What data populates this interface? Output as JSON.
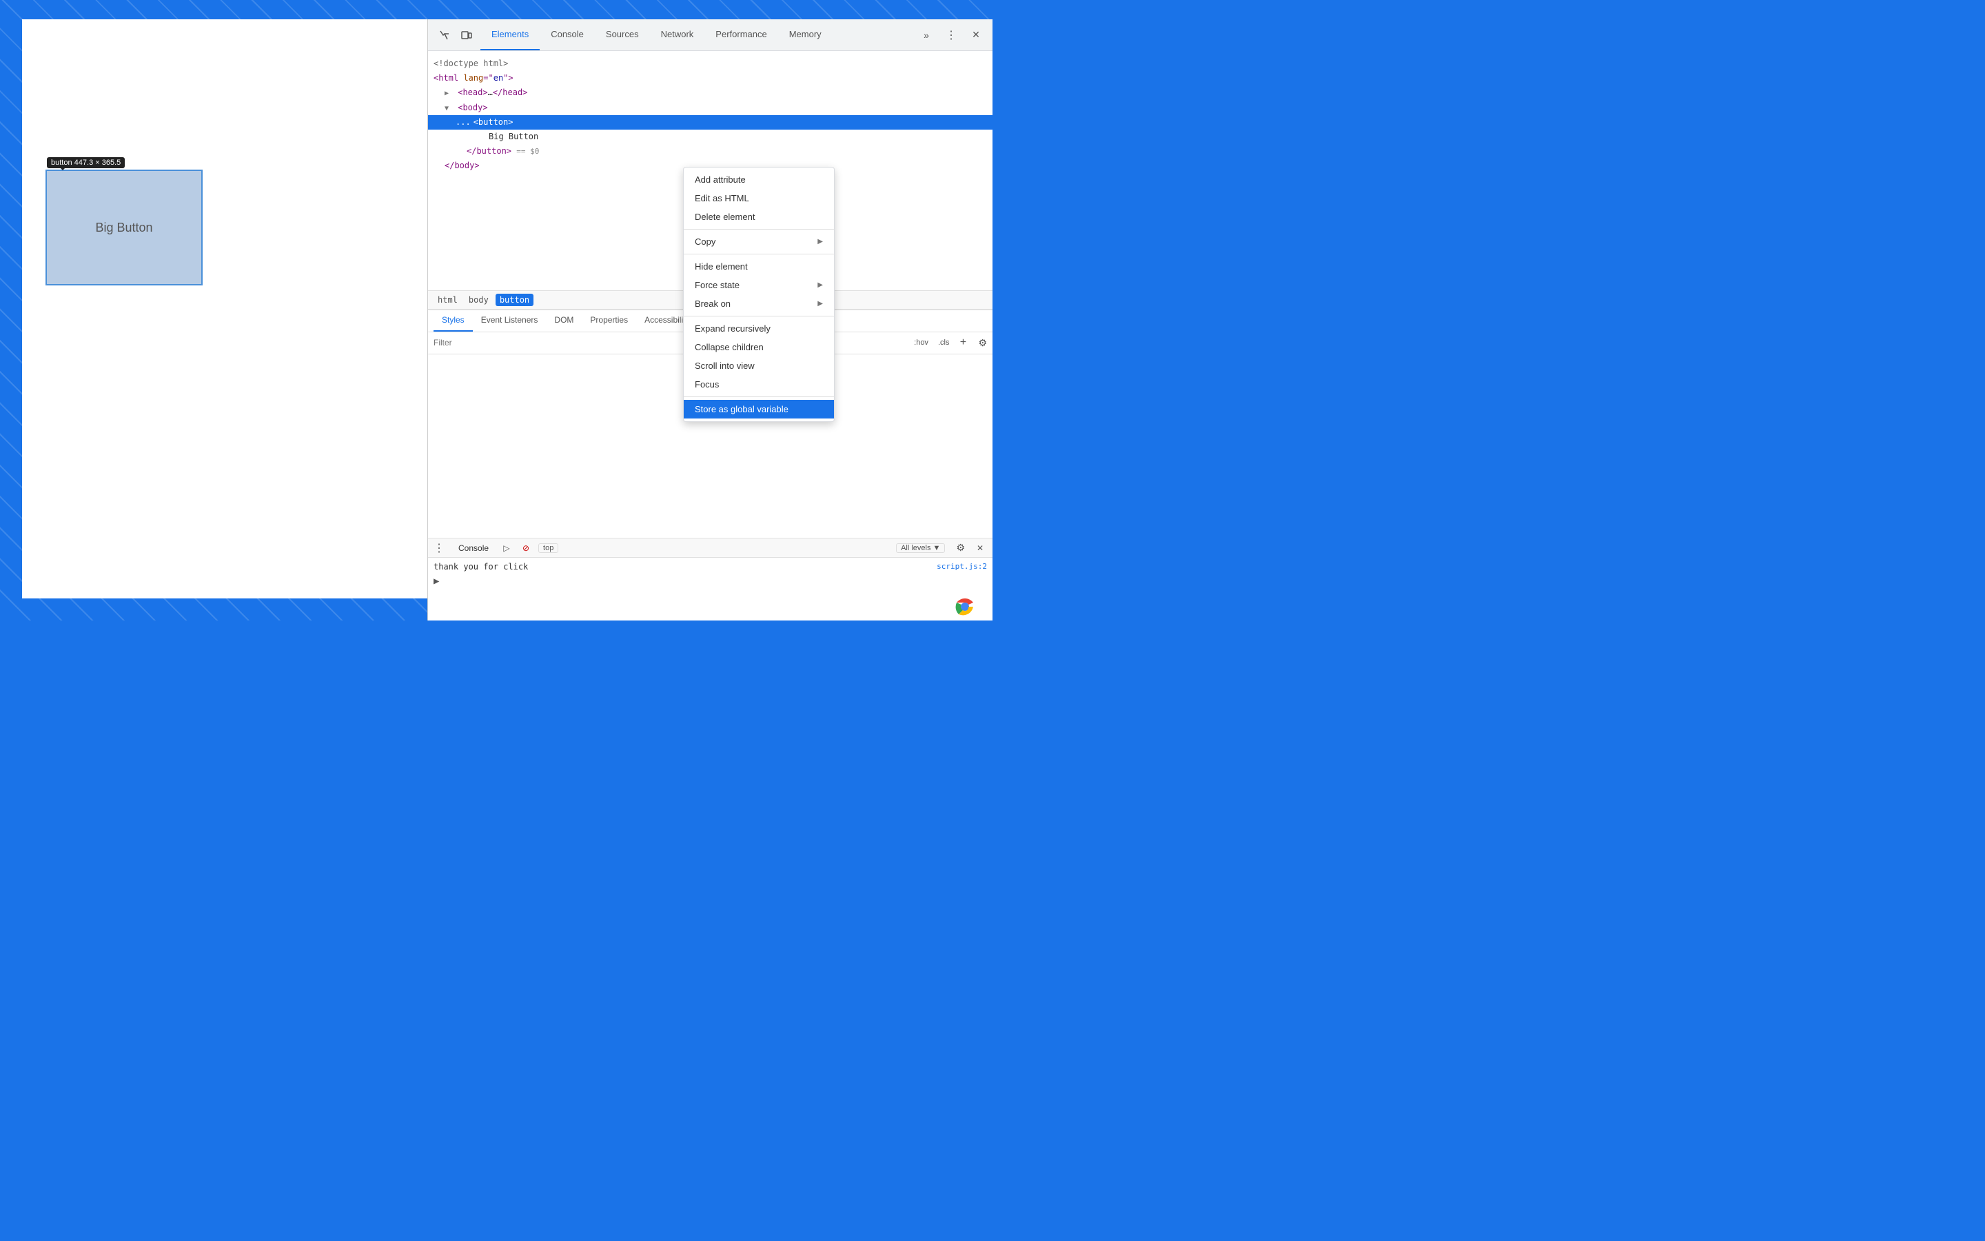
{
  "browser": {
    "top_bar_height": 28
  },
  "tooltip": {
    "text": "button",
    "dimensions": "447.3 × 365.5"
  },
  "big_button": {
    "label": "Big Button"
  },
  "devtools": {
    "toolbar": {
      "inspect_icon": "⬚",
      "device_icon": "⧉",
      "more_tabs_icon": "»",
      "three_dots_icon": "⋮",
      "close_icon": "✕"
    },
    "tabs": [
      {
        "label": "Elements",
        "active": true
      },
      {
        "label": "Console",
        "active": false
      },
      {
        "label": "Sources",
        "active": false
      },
      {
        "label": "Network",
        "active": false
      },
      {
        "label": "Performance",
        "active": false
      },
      {
        "label": "Memory",
        "active": false
      }
    ],
    "html": {
      "lines": [
        {
          "text": "<!doctype html>",
          "type": "doctype",
          "indent": 0
        },
        {
          "text": "<html lang=\"en\">",
          "type": "tag",
          "indent": 0,
          "expandable": false
        },
        {
          "text": "▶ <head>...</head>",
          "type": "tag",
          "indent": 1,
          "collapsed": true
        },
        {
          "text": "▼ <body>",
          "type": "tag",
          "indent": 1,
          "collapsed": false
        },
        {
          "text": "...  <button>",
          "type": "selected",
          "indent": 2
        },
        {
          "text": "Big Button",
          "type": "text",
          "indent": 4
        },
        {
          "text": "</button> == $0",
          "type": "tag",
          "indent": 3
        },
        {
          "text": "</body>",
          "type": "tag",
          "indent": 1
        }
      ]
    },
    "breadcrumb": [
      {
        "label": "html",
        "active": false
      },
      {
        "label": "body",
        "active": false
      },
      {
        "label": "button",
        "active": true
      }
    ],
    "styles_tabs": [
      {
        "label": "Styles",
        "active": true
      },
      {
        "label": "Event Listeners",
        "active": false
      },
      {
        "label": "DOM",
        "active": false
      },
      {
        "label": "Properties",
        "active": false
      },
      {
        "label": "Accessibility",
        "active": false
      }
    ],
    "filter_placeholder": "Filter",
    "hov_label": ":hov",
    "cls_label": ".cls",
    "plus_label": "+",
    "gear_label": "⚙",
    "console": {
      "title": "Console",
      "log_text": "thank you for click",
      "log_source": "script.js:2",
      "top_label": "top",
      "all_levels_label": "All levels ▼",
      "prompt": ">"
    }
  },
  "context_menu": {
    "items": [
      {
        "label": "Add attribute",
        "has_submenu": false
      },
      {
        "label": "Edit as HTML",
        "has_submenu": false
      },
      {
        "label": "Delete element",
        "has_submenu": false
      },
      {
        "label": "divider",
        "type": "divider"
      },
      {
        "label": "Copy",
        "has_submenu": true
      },
      {
        "label": "divider2",
        "type": "divider"
      },
      {
        "label": "Hide element",
        "has_submenu": false
      },
      {
        "label": "Force state",
        "has_submenu": true
      },
      {
        "label": "Break on",
        "has_submenu": true
      },
      {
        "label": "divider3",
        "type": "divider"
      },
      {
        "label": "Expand recursively",
        "has_submenu": false
      },
      {
        "label": "Collapse children",
        "has_submenu": false
      },
      {
        "label": "Scroll into view",
        "has_submenu": false
      },
      {
        "label": "Focus",
        "has_submenu": false
      },
      {
        "label": "divider4",
        "type": "divider"
      },
      {
        "label": "Store as global variable",
        "has_submenu": false,
        "highlighted": true
      }
    ]
  }
}
